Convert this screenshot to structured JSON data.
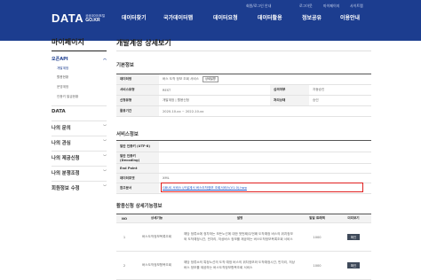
{
  "header": {
    "logo": {
      "main": "DATA",
      "sub_ko": "공공데이터포털",
      "domain": "GO.KR"
    },
    "utility_links": [
      "회원/로그인 안내",
      "로그아웃",
      "마이페이지",
      "사이트맵"
    ],
    "gnb": [
      "데이터찾기",
      "국가데이터맵",
      "데이터요청",
      "데이터활용",
      "정보공유",
      "이용안내"
    ]
  },
  "sidebar": {
    "title": "마이페이지",
    "current": "오픈API",
    "sub_items": [
      "개발계정",
      "활용현황",
      "운영계정",
      "인증키 발급현황"
    ],
    "sections": [
      "DATA",
      "나의 문의",
      "나의 관심",
      "나의 제공신청",
      "나의 분쟁조정",
      "회원정보 수정"
    ]
  },
  "main": {
    "title": "개발계정 상세보기",
    "basic": {
      "section_title": "기본정보",
      "rows": [
        {
          "label": "데이터명",
          "value": "버스 도착 정보 조회 서비스",
          "button": "상세설명"
        },
        {
          "label": "서비스유형",
          "value": "REST",
          "label2": "심의여부",
          "value2": "자동승인"
        },
        {
          "label": "신청유형",
          "value": "개발계정 | 활용신청",
          "label2": "처리상태",
          "value2": "승인"
        },
        {
          "label": "활용기간",
          "value": "2020-10-xx ~ 2022-10-xx"
        }
      ]
    },
    "service": {
      "section_title": "서비스정보",
      "rows": [
        {
          "label": "일반 인증키 (UTF-8)",
          "value": ""
        },
        {
          "label": "일반 인증키 (Decoding)",
          "value": ""
        },
        {
          "label": "End Point",
          "value": ""
        },
        {
          "label": "데이터포맷",
          "value": "XML"
        },
        {
          "label": "참고문서",
          "value": "GBUS 서비스 I/F설계서 버스도착정보 조회서비스(V1.0).hwp"
        }
      ]
    },
    "detail": {
      "section_title": "활용신청 상세기능정보",
      "columns": [
        "NO",
        "상세기능",
        "설명",
        "일일 트래픽",
        "미리보기"
      ],
      "rows": [
        {
          "no": "1",
          "name": "버스도착정보목록조회",
          "desc": [
            "해당 정류소에 정차하는 모든노선에 대한 첫번째/두번째 도착예정 버스의 위치정보와 도착예정시간, 빈자리, 저상버스 정보를 제공하는 버스도착정보목록조회 서비스"
          ],
          "traffic": "1000",
          "preview": "확인"
        },
        {
          "no": "2",
          "name": "버스도착정보항목조회",
          "desc": [
            "해당 정류소의 특정노선의 도착 예정 버스의 위치정보와 도착예정시간, 빈자리, 저상버스 정보를 제공하는 버스도착정보항목조회 서비스"
          ],
          "traffic": "1000",
          "preview": "확인"
        }
      ]
    }
  },
  "colors": {
    "header_bg": "#1c3d8f",
    "highlight_border": "#e02020",
    "link": "#1c55c9"
  }
}
